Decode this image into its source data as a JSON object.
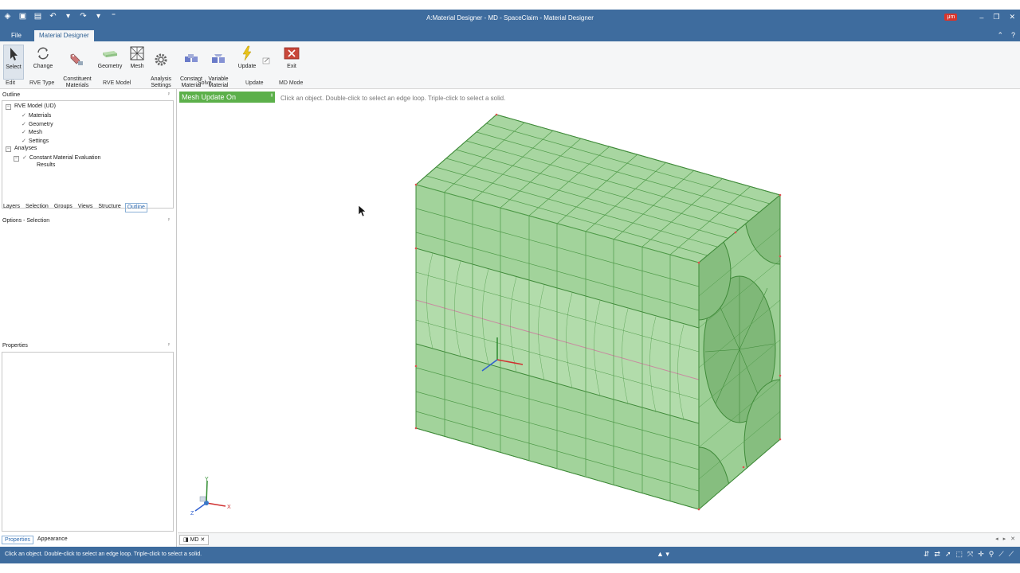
{
  "window": {
    "title": "A:Material Designer - MD - SpaceClaim - Material Designer",
    "badge": "μm",
    "controls": [
      "–",
      "❐",
      "✕"
    ]
  },
  "quick_access": [
    "◈",
    "▣",
    "▤",
    "↶",
    "▾",
    "↷",
    "▾",
    "⁼"
  ],
  "ribbon_tabs": [
    {
      "label": "File",
      "active": false
    },
    {
      "label": "Material Designer",
      "active": true
    }
  ],
  "ribbon": {
    "buttons": [
      {
        "label": "Select",
        "icon": "cursor-arrow-icon"
      },
      {
        "label": "Change",
        "icon": "cycle-arrows-icon"
      },
      {
        "label": "Constituent\nMaterials",
        "icon": "material-tag-icon"
      },
      {
        "label": "Geometry",
        "icon": "geometry-slab-icon"
      },
      {
        "label": "Mesh",
        "icon": "mesh-grid-icon"
      },
      {
        "label": "Analysis\nSettings",
        "icon": "gear-icon"
      },
      {
        "label": "Constant\nMaterial",
        "icon": "constant-material-icon"
      },
      {
        "label": "Variable\nMaterial",
        "icon": "variable-material-icon"
      },
      {
        "label": "Update",
        "icon": "lightning-icon"
      },
      {
        "label": "Exit",
        "icon": "exit-icon"
      }
    ],
    "groups": [
      "Edit",
      "RVE Type",
      "RVE Model",
      "Solve",
      "Update",
      "MD Mode"
    ]
  },
  "outline": {
    "title": "Outline",
    "tree": [
      {
        "label": "RVE Model (UD)",
        "level": 0,
        "expander": "−"
      },
      {
        "label": "Materials",
        "level": 1,
        "check": "✓"
      },
      {
        "label": "Geometry",
        "level": 1,
        "check": "✓"
      },
      {
        "label": "Mesh",
        "level": 1,
        "check": "✓"
      },
      {
        "label": "Settings",
        "level": 1,
        "check": "✓"
      },
      {
        "label": "Analyses",
        "level": 0,
        "expander": "−"
      },
      {
        "label": "Constant Material Evaluation",
        "level": 1,
        "check": "✓",
        "expander": "−"
      },
      {
        "label": "Results",
        "level": 2
      }
    ]
  },
  "panel_tabs": [
    {
      "label": "Layers",
      "active": false
    },
    {
      "label": "Selection",
      "active": false
    },
    {
      "label": "Groups",
      "active": false
    },
    {
      "label": "Views",
      "active": false
    },
    {
      "label": "Structure",
      "active": false
    },
    {
      "label": "Outline",
      "active": true
    }
  ],
  "options_panel": {
    "title": "Options - Selection"
  },
  "properties_panel": {
    "title": "Properties"
  },
  "bottom_tabs": [
    {
      "label": "Properties",
      "active": true
    },
    {
      "label": "Appearance",
      "active": false
    }
  ],
  "viewport": {
    "mesh_badge": "Mesh Update On",
    "hint": "Click an object. Double-click to select an edge loop. Triple-click to select a solid.",
    "triad_labels": {
      "x": "X",
      "y": "Y",
      "z": "Z"
    },
    "model_color": "#9fd19a"
  },
  "document_tab": {
    "label": "MD"
  },
  "status": {
    "message": "Click an object. Double-click to select an edge loop. Triple-click to select a solid."
  },
  "colors": {
    "title_bar": "#3e6c9e",
    "mesh_badge": "#5cb04a",
    "accent": "#2d6ab0"
  }
}
